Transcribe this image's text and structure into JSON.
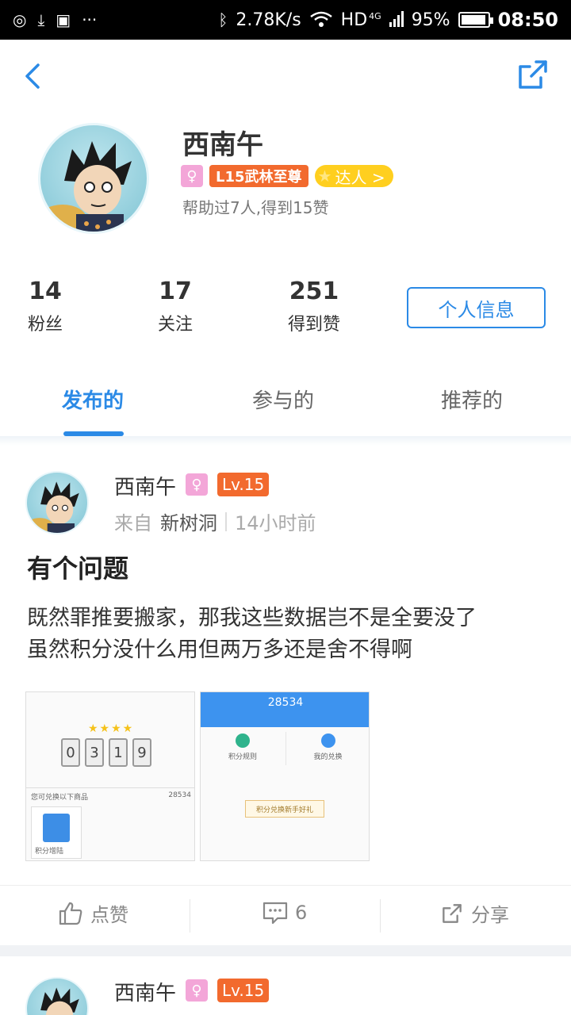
{
  "statusbar": {
    "net_speed": "2.78K/s",
    "network": "HD",
    "network_sub": "4G",
    "battery": "95%",
    "battery_level": 0.95,
    "time": "08:50",
    "left_icons": [
      "hotspot-icon",
      "download-icon",
      "image-icon",
      "more-icon"
    ]
  },
  "profile": {
    "name": "西南午",
    "level_badge": "L15武林至尊",
    "daren_badge": "达人 >",
    "helped_text": "帮助过7人,得到15赞"
  },
  "stats": [
    {
      "num": "14",
      "label": "粉丝"
    },
    {
      "num": "17",
      "label": "关注"
    },
    {
      "num": "251",
      "label": "得到赞"
    }
  ],
  "info_button": "个人信息",
  "tabs": [
    {
      "label": "发布的",
      "active": true
    },
    {
      "label": "参与的",
      "active": false
    },
    {
      "label": "推荐的",
      "active": false
    }
  ],
  "posts": [
    {
      "author": "西南午",
      "level": "Lv.15",
      "from_label": "来自",
      "source": "新树洞",
      "time": "14小时前",
      "title": "有个问题",
      "body_line1": "既然罪推要搬家，那我这些数据岂不是全要没了",
      "body_line2": "虽然积分没什么用但两万多还是舍不得啊",
      "images": [
        {
          "digits": [
            "0",
            "3",
            "1",
            "9"
          ],
          "row_left": "您可兑换以下商品",
          "row_right": "28534",
          "card_label": "积分增陆"
        },
        {
          "points": "28534",
          "option1": "积分规则",
          "option2": "我的兑换",
          "note": "积分兑换新手好礼"
        }
      ],
      "actions": {
        "like": "点赞",
        "comment_count": "6",
        "share": "分享"
      }
    },
    {
      "author": "西南午",
      "level": "Lv.15"
    }
  ],
  "colors": {
    "accent": "#2b8ae6",
    "level": "#f26a2e",
    "female": "#f3a6d8",
    "daren": "#ffcf1f"
  }
}
